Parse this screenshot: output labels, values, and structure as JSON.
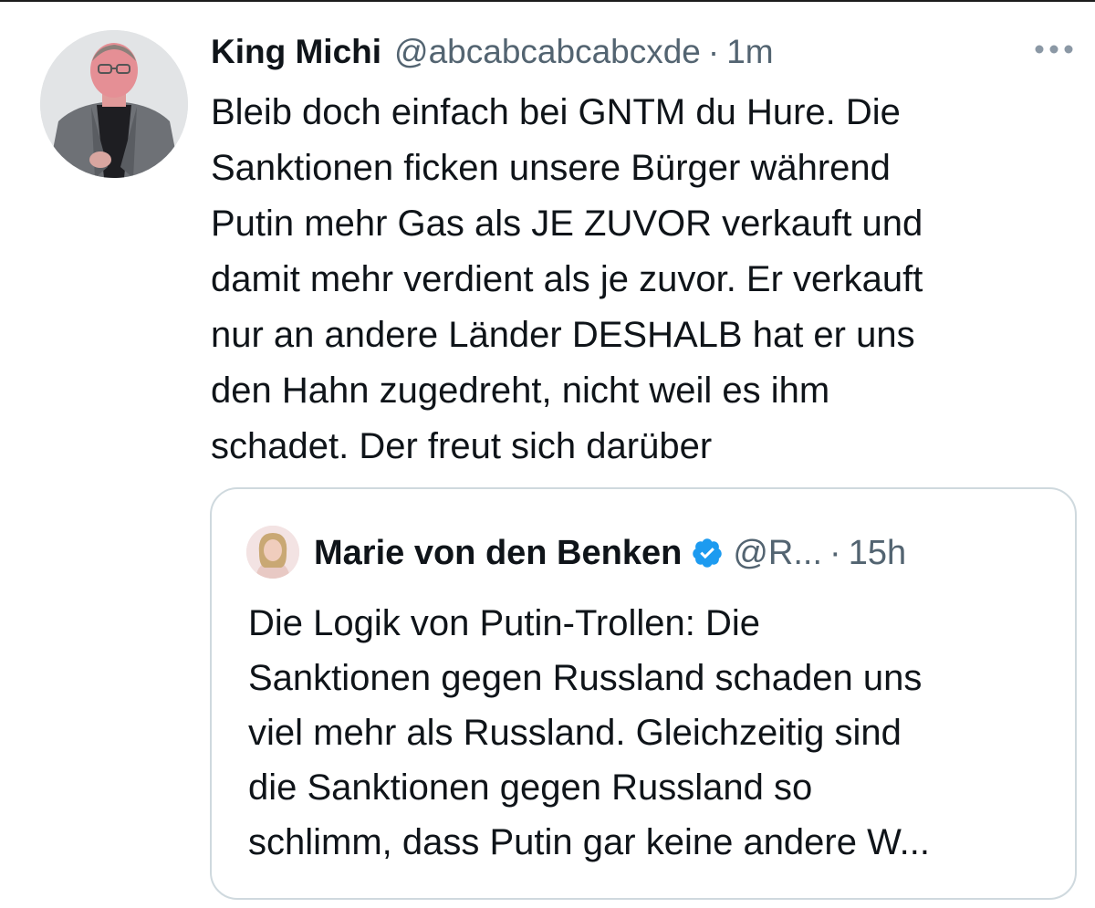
{
  "tweet": {
    "display_name": "King Michi",
    "handle": "@abcabcabcabcxde",
    "separator": "·",
    "time": "1m",
    "more_icon": "more-horizontal-icon",
    "text": "Bleib doch einfach bei GNTM du Hure. Die\nSanktionen ficken unsere Bürger während\nPutin mehr Gas als JE ZUVOR verkauft und\ndamit mehr verdient als je zuvor. Er verkauft\nnur an andere Länder DESHALB hat er uns\nden Hahn zugedreht, nicht weil es ihm\nschadet. Der freut sich darüber"
  },
  "quoted_tweet": {
    "display_name": "Marie von den Benken",
    "verified_icon": "verified-badge-icon",
    "handle": "@R...",
    "separator": "·",
    "time": "15h",
    "text": "Die Logik von Putin-Trollen: Die\nSanktionen gegen Russland schaden uns\nviel mehr als Russland. Gleichzeitig sind\ndie Sanktionen gegen Russland so\nschlimm, dass Putin gar keine andere W..."
  },
  "colors": {
    "text_primary": "#0f1419",
    "text_secondary": "#536471",
    "border": "#cfd9de",
    "verified_blue": "#1d9bf0"
  }
}
